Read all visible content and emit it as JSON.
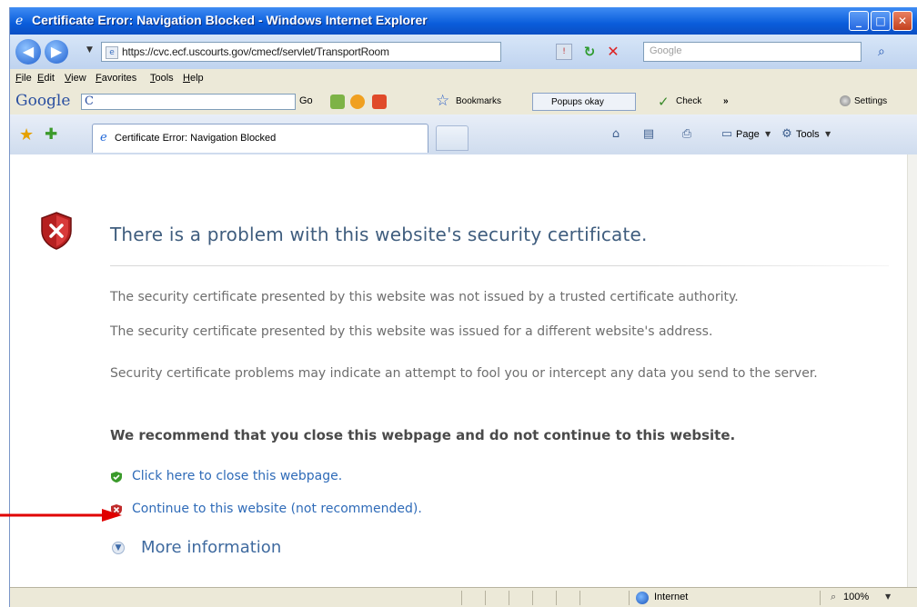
{
  "window": {
    "title": "Certificate Error: Navigation Blocked - Windows Internet Explorer"
  },
  "address_bar": {
    "url": "https://cvc.ecf.uscourts.gov/cmecf/servlet/TransportRoom",
    "search_placeholder": "Google"
  },
  "menu": [
    "File",
    "Edit",
    "View",
    "Favorites",
    "Tools",
    "Help"
  ],
  "google_toolbar": {
    "logo": "Google",
    "box_letter": "C",
    "go_label": "Go",
    "bookmarks_label": "Bookmarks",
    "popups_label": "Popups okay",
    "check_label": "Check",
    "more_label": "»",
    "settings_label": "Settings"
  },
  "tabs": [
    {
      "label": "Certificate Error: Navigation Blocked"
    }
  ],
  "command_bar": {
    "page_label": "Page",
    "tools_label": "Tools"
  },
  "page": {
    "heading": "There is a problem with this website's security certificate.",
    "p1_line1": "The security certificate presented by this website was not issued by a trusted certificate authority.",
    "p1_line2": "The security certificate presented by this website was issued for a different website's address.",
    "p2": "Security certificate problems may indicate an attempt to fool you or intercept any data you send to the server.",
    "recommendation": "We recommend that you close this webpage and do not continue to this website.",
    "close_link": "Click here to close this webpage.",
    "continue_link": "Continue to this website (not recommended).",
    "more_info": "More information"
  },
  "status_bar": {
    "zone": "Internet",
    "zoom": "100%"
  },
  "colors": {
    "titlebar": "#0a5ddb",
    "heading": "#3f5d7e",
    "link": "#2f6bb8",
    "annotation_arrow": "#e00000"
  }
}
